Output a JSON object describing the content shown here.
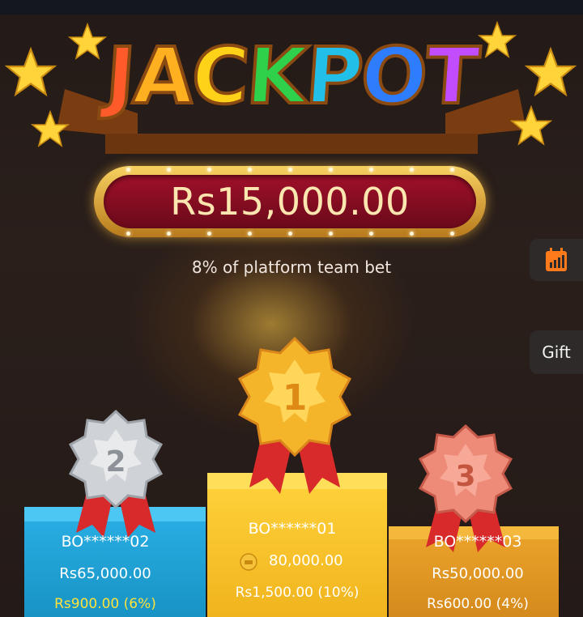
{
  "header": {
    "logo_text": "JACKPOT",
    "logo_letter_colors": [
      "#ff5a2a",
      "#ffb020",
      "#ffd21a",
      "#2fd04a",
      "#22c0e8",
      "#2f7dff",
      "#c24cff"
    ]
  },
  "jackpot": {
    "amount": "Rs15,000.00",
    "subtitle": "8% of platform team bet"
  },
  "side_buttons": {
    "calendar_icon": "calendar-chart-icon",
    "gift_label": "Gift"
  },
  "podium": {
    "first": {
      "rank": "1",
      "name": "BO******01",
      "amount": "80,000.00",
      "bonus": "Rs1,500.00 (10%)",
      "coin_icon": "coin-icon"
    },
    "second": {
      "rank": "2",
      "name": "BO******02",
      "amount": "Rs65,000.00",
      "bonus": "Rs900.00 (6%)"
    },
    "third": {
      "rank": "3",
      "name": "BO******03",
      "amount": "Rs50,000.00",
      "bonus": "Rs600.00 (4%)"
    }
  },
  "colors": {
    "podium_first": "#f0b41e",
    "podium_second": "#1893c4",
    "podium_third": "#d58a1c",
    "medal_gold": "#f5b52a",
    "medal_silver": "#cfd2d6",
    "medal_bronze": "#ee8a78",
    "ribbon_red": "#d82a2a"
  }
}
